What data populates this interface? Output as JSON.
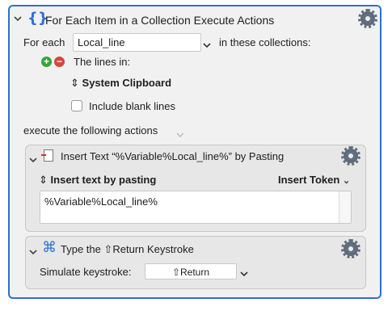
{
  "action": {
    "title": "For Each Item in a Collection Execute Actions",
    "for_each_label": "For each",
    "variable_value": "Local_line",
    "in_collections_label": "in these collections:",
    "collection": {
      "label": "The lines in:",
      "source": "System Clipboard",
      "include_blank_label": "Include blank lines",
      "include_blank_checked": false
    },
    "execute_label": "execute the following actions",
    "accent_color": "#2f6ed6"
  },
  "sub_actions": [
    {
      "title": "Insert Text “%Variable%Local_line%” by Pasting",
      "mode": "Insert text by pasting",
      "insert_token_label": "Insert Token",
      "text_value": "%Variable%Local_line%"
    },
    {
      "title": "Type the ⇧Return Keystroke",
      "simulate_label": "Simulate keystroke:",
      "keystroke_value": "⇧Return"
    }
  ],
  "icons": {
    "disclosure": "chevron-down-icon",
    "gear": "gear-icon",
    "braces": "curly-braces-icon",
    "add": "plus-circle-icon",
    "remove": "minus-circle-icon",
    "command": "command-key-icon",
    "document": "document-icon"
  }
}
